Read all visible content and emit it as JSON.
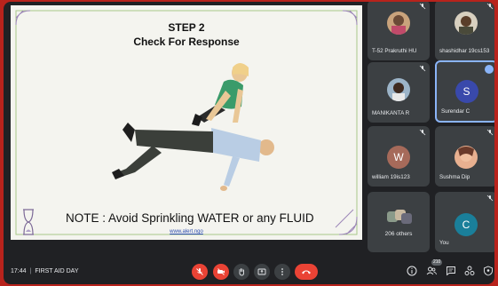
{
  "slide": {
    "step_title": "STEP 2",
    "step_subtitle": "Check For Response",
    "note": "NOTE : Avoid Sprinkling WATER or any FLUID",
    "link": "www.alert.ngo"
  },
  "participants": [
    {
      "name": "T-52 Prakruthi HU",
      "muted": true,
      "avatar": "photo"
    },
    {
      "name": "shashidhar 19cs153",
      "muted": true,
      "avatar": "photo"
    },
    {
      "name": "MANIKANTA R",
      "muted": true,
      "avatar": "photo"
    },
    {
      "name": "Surendar C",
      "speaking": true,
      "avatar_letter": "S",
      "avatar_color": "#3949ab"
    },
    {
      "name": "william 19is123",
      "muted": true,
      "avatar_letter": "W",
      "avatar_color": "#a66a5a"
    },
    {
      "name": "Sushma Dip",
      "muted": true,
      "avatar": "photo"
    },
    {
      "name": "206 others",
      "avatar": "group"
    },
    {
      "name": "You",
      "muted": true,
      "avatar_letter": "C",
      "avatar_color": "#1a7f9a"
    }
  ],
  "bottom_bar": {
    "time": "17:44",
    "meeting_name": "FIRST AID DAY",
    "people_count": "210"
  },
  "colors": {
    "background": "#202124",
    "tile": "#3c4043",
    "danger": "#ea4335",
    "accent": "#8ab4f8"
  }
}
